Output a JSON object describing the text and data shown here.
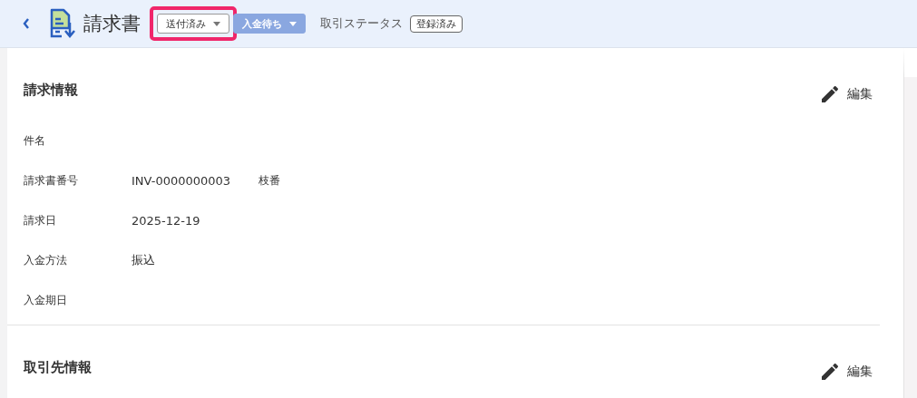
{
  "header": {
    "title": "請求書",
    "status_dropdowns": [
      {
        "label": "送付済み",
        "kind": "outlined",
        "highlighted": true
      },
      {
        "label": "入金待ち",
        "kind": "filled",
        "highlighted": false
      }
    ],
    "status_caption": "取引ステータス",
    "status_badge": "登録済み"
  },
  "sections": [
    {
      "title": "請求情報",
      "edit_label": "編集",
      "fields": [
        {
          "label": "件名"
        },
        {
          "label": "請求書番号",
          "value": "INV-0000000003",
          "sub_label": "枝番"
        },
        {
          "label": "請求日",
          "value": "2025-12-19"
        },
        {
          "label": "入金方法",
          "value": "振込"
        },
        {
          "label": "入金期日"
        }
      ]
    },
    {
      "title": "取引先情報",
      "edit_label": "編集"
    }
  ]
}
